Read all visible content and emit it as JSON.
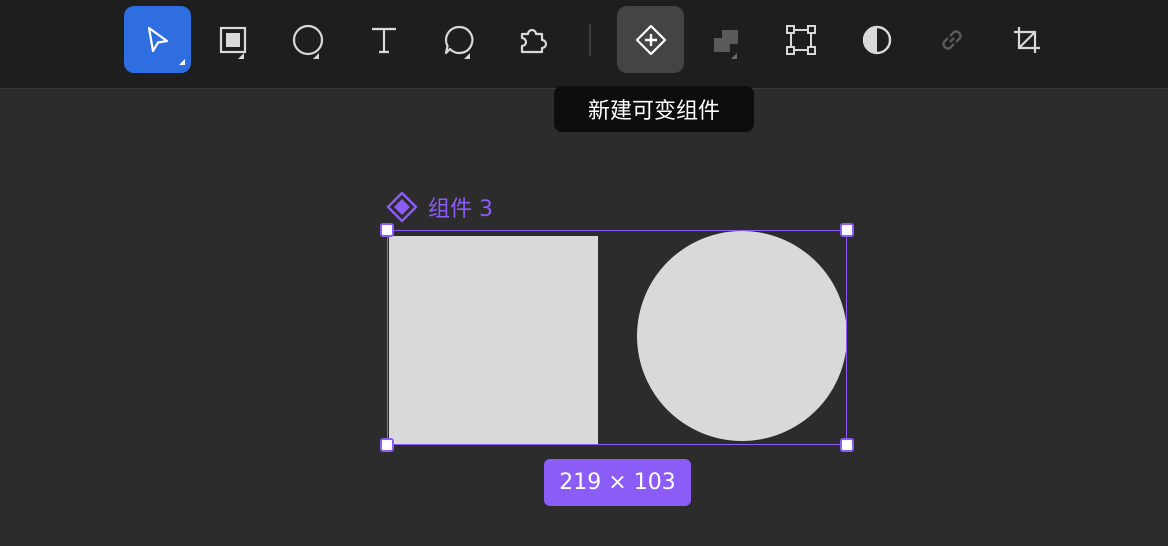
{
  "toolbar": {
    "tools": [
      {
        "name": "select-tool",
        "icon": "pointer-arrow-icon",
        "active": true,
        "has_submenu": true
      },
      {
        "name": "rectangle-tool",
        "icon": "rectangle-icon",
        "has_submenu": true
      },
      {
        "name": "ellipse-tool",
        "icon": "ellipse-icon",
        "has_submenu": true
      },
      {
        "name": "text-tool",
        "icon": "text-icon"
      },
      {
        "name": "comment-tool",
        "icon": "comment-bubble-icon",
        "has_submenu": true
      },
      {
        "name": "plugin-tool",
        "icon": "puzzle-icon"
      },
      {
        "name": "create-variable-component-tool",
        "icon": "component-add-icon",
        "hovered": true
      },
      {
        "name": "boolean-tool",
        "icon": "boolean-union-icon",
        "has_submenu": true,
        "disabled": true
      },
      {
        "name": "frame-points-tool",
        "icon": "vector-frame-icon"
      },
      {
        "name": "mask-tool",
        "icon": "half-circle-icon"
      },
      {
        "name": "link-tool",
        "icon": "link-icon",
        "disabled": true
      },
      {
        "name": "crop-tool",
        "icon": "crop-icon"
      }
    ],
    "tooltip": "新建可变组件"
  },
  "canvas": {
    "component_label": "组件 3",
    "component_icon": "component-diamond-icon",
    "dimensions": "219 × 103"
  },
  "colors": {
    "accent_blue": "#2f6ee0",
    "selection_purple": "#8b5cf6",
    "shape_fill": "#d9d9d9",
    "canvas_bg": "#2c2c2c",
    "toolbar_bg": "#1e1e1e"
  }
}
